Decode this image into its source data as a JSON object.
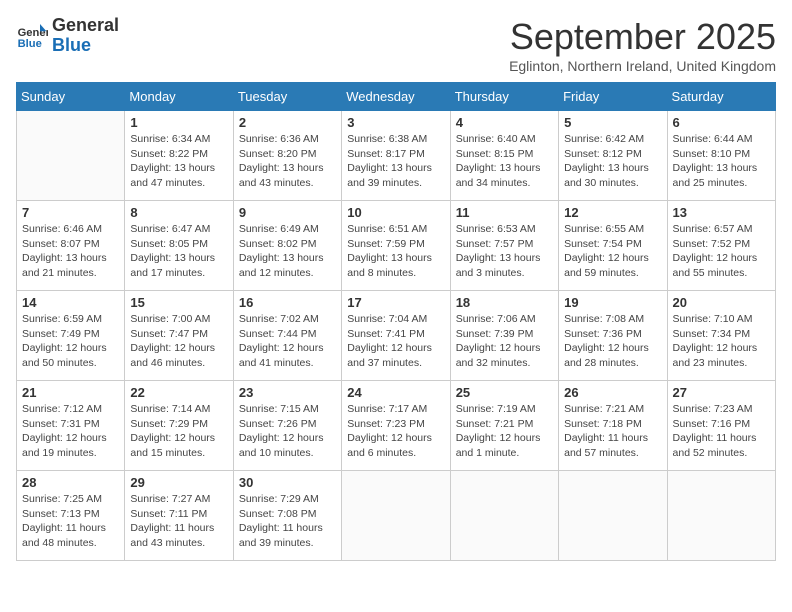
{
  "logo": {
    "line1": "General",
    "line2": "Blue"
  },
  "title": "September 2025",
  "subtitle": "Eglinton, Northern Ireland, United Kingdom",
  "weekdays": [
    "Sunday",
    "Monday",
    "Tuesday",
    "Wednesday",
    "Thursday",
    "Friday",
    "Saturday"
  ],
  "weeks": [
    [
      {
        "day": "",
        "content": ""
      },
      {
        "day": "1",
        "content": "Sunrise: 6:34 AM\nSunset: 8:22 PM\nDaylight: 13 hours and 47 minutes."
      },
      {
        "day": "2",
        "content": "Sunrise: 6:36 AM\nSunset: 8:20 PM\nDaylight: 13 hours and 43 minutes."
      },
      {
        "day": "3",
        "content": "Sunrise: 6:38 AM\nSunset: 8:17 PM\nDaylight: 13 hours and 39 minutes."
      },
      {
        "day": "4",
        "content": "Sunrise: 6:40 AM\nSunset: 8:15 PM\nDaylight: 13 hours and 34 minutes."
      },
      {
        "day": "5",
        "content": "Sunrise: 6:42 AM\nSunset: 8:12 PM\nDaylight: 13 hours and 30 minutes."
      },
      {
        "day": "6",
        "content": "Sunrise: 6:44 AM\nSunset: 8:10 PM\nDaylight: 13 hours and 25 minutes."
      }
    ],
    [
      {
        "day": "7",
        "content": "Sunrise: 6:46 AM\nSunset: 8:07 PM\nDaylight: 13 hours and 21 minutes."
      },
      {
        "day": "8",
        "content": "Sunrise: 6:47 AM\nSunset: 8:05 PM\nDaylight: 13 hours and 17 minutes."
      },
      {
        "day": "9",
        "content": "Sunrise: 6:49 AM\nSunset: 8:02 PM\nDaylight: 13 hours and 12 minutes."
      },
      {
        "day": "10",
        "content": "Sunrise: 6:51 AM\nSunset: 7:59 PM\nDaylight: 13 hours and 8 minutes."
      },
      {
        "day": "11",
        "content": "Sunrise: 6:53 AM\nSunset: 7:57 PM\nDaylight: 13 hours and 3 minutes."
      },
      {
        "day": "12",
        "content": "Sunrise: 6:55 AM\nSunset: 7:54 PM\nDaylight: 12 hours and 59 minutes."
      },
      {
        "day": "13",
        "content": "Sunrise: 6:57 AM\nSunset: 7:52 PM\nDaylight: 12 hours and 55 minutes."
      }
    ],
    [
      {
        "day": "14",
        "content": "Sunrise: 6:59 AM\nSunset: 7:49 PM\nDaylight: 12 hours and 50 minutes."
      },
      {
        "day": "15",
        "content": "Sunrise: 7:00 AM\nSunset: 7:47 PM\nDaylight: 12 hours and 46 minutes."
      },
      {
        "day": "16",
        "content": "Sunrise: 7:02 AM\nSunset: 7:44 PM\nDaylight: 12 hours and 41 minutes."
      },
      {
        "day": "17",
        "content": "Sunrise: 7:04 AM\nSunset: 7:41 PM\nDaylight: 12 hours and 37 minutes."
      },
      {
        "day": "18",
        "content": "Sunrise: 7:06 AM\nSunset: 7:39 PM\nDaylight: 12 hours and 32 minutes."
      },
      {
        "day": "19",
        "content": "Sunrise: 7:08 AM\nSunset: 7:36 PM\nDaylight: 12 hours and 28 minutes."
      },
      {
        "day": "20",
        "content": "Sunrise: 7:10 AM\nSunset: 7:34 PM\nDaylight: 12 hours and 23 minutes."
      }
    ],
    [
      {
        "day": "21",
        "content": "Sunrise: 7:12 AM\nSunset: 7:31 PM\nDaylight: 12 hours and 19 minutes."
      },
      {
        "day": "22",
        "content": "Sunrise: 7:14 AM\nSunset: 7:29 PM\nDaylight: 12 hours and 15 minutes."
      },
      {
        "day": "23",
        "content": "Sunrise: 7:15 AM\nSunset: 7:26 PM\nDaylight: 12 hours and 10 minutes."
      },
      {
        "day": "24",
        "content": "Sunrise: 7:17 AM\nSunset: 7:23 PM\nDaylight: 12 hours and 6 minutes."
      },
      {
        "day": "25",
        "content": "Sunrise: 7:19 AM\nSunset: 7:21 PM\nDaylight: 12 hours and 1 minute."
      },
      {
        "day": "26",
        "content": "Sunrise: 7:21 AM\nSunset: 7:18 PM\nDaylight: 11 hours and 57 minutes."
      },
      {
        "day": "27",
        "content": "Sunrise: 7:23 AM\nSunset: 7:16 PM\nDaylight: 11 hours and 52 minutes."
      }
    ],
    [
      {
        "day": "28",
        "content": "Sunrise: 7:25 AM\nSunset: 7:13 PM\nDaylight: 11 hours and 48 minutes."
      },
      {
        "day": "29",
        "content": "Sunrise: 7:27 AM\nSunset: 7:11 PM\nDaylight: 11 hours and 43 minutes."
      },
      {
        "day": "30",
        "content": "Sunrise: 7:29 AM\nSunset: 7:08 PM\nDaylight: 11 hours and 39 minutes."
      },
      {
        "day": "",
        "content": ""
      },
      {
        "day": "",
        "content": ""
      },
      {
        "day": "",
        "content": ""
      },
      {
        "day": "",
        "content": ""
      }
    ]
  ]
}
